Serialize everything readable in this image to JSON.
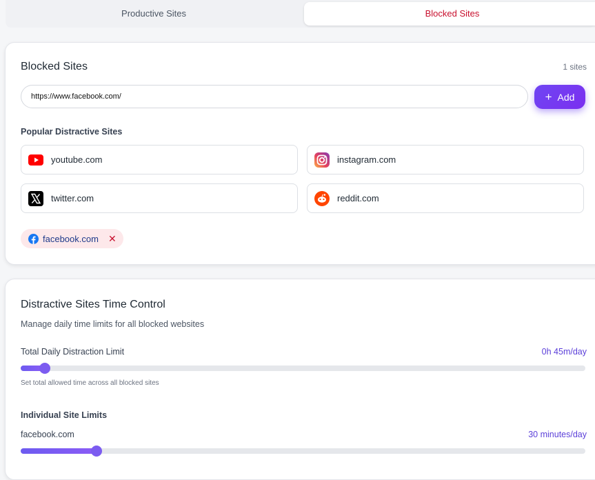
{
  "tabs": {
    "productive": "Productive Sites",
    "blocked": "Blocked Sites"
  },
  "blocked_card": {
    "title": "Blocked Sites",
    "count": "1 sites",
    "input_value": "https://www.facebook.com/",
    "add_label": "Add",
    "popular_title": "Popular Distractive Sites",
    "popular": [
      {
        "name": "youtube.com",
        "icon": "youtube-icon"
      },
      {
        "name": "instagram.com",
        "icon": "instagram-icon"
      },
      {
        "name": "twitter.com",
        "icon": "x-twitter-icon"
      },
      {
        "name": "reddit.com",
        "icon": "reddit-icon"
      }
    ],
    "blocked_chip": {
      "name": "facebook.com",
      "icon": "facebook-icon",
      "remove": "✕"
    }
  },
  "time_card": {
    "title": "Distractive Sites Time Control",
    "subtitle": "Manage daily time limits for all blocked websites",
    "total_label": "Total Daily Distraction Limit",
    "total_value": "0h 45m/day",
    "total_fraction": 0.043,
    "total_hint": "Set total allowed time across all blocked sites",
    "individual_title": "Individual Site Limits",
    "site_label": "facebook.com",
    "site_value": "30 minutes/day",
    "site_fraction": 0.134
  },
  "colors": {
    "accent": "#7b3ff0",
    "blocked_red": "#c8102e"
  }
}
